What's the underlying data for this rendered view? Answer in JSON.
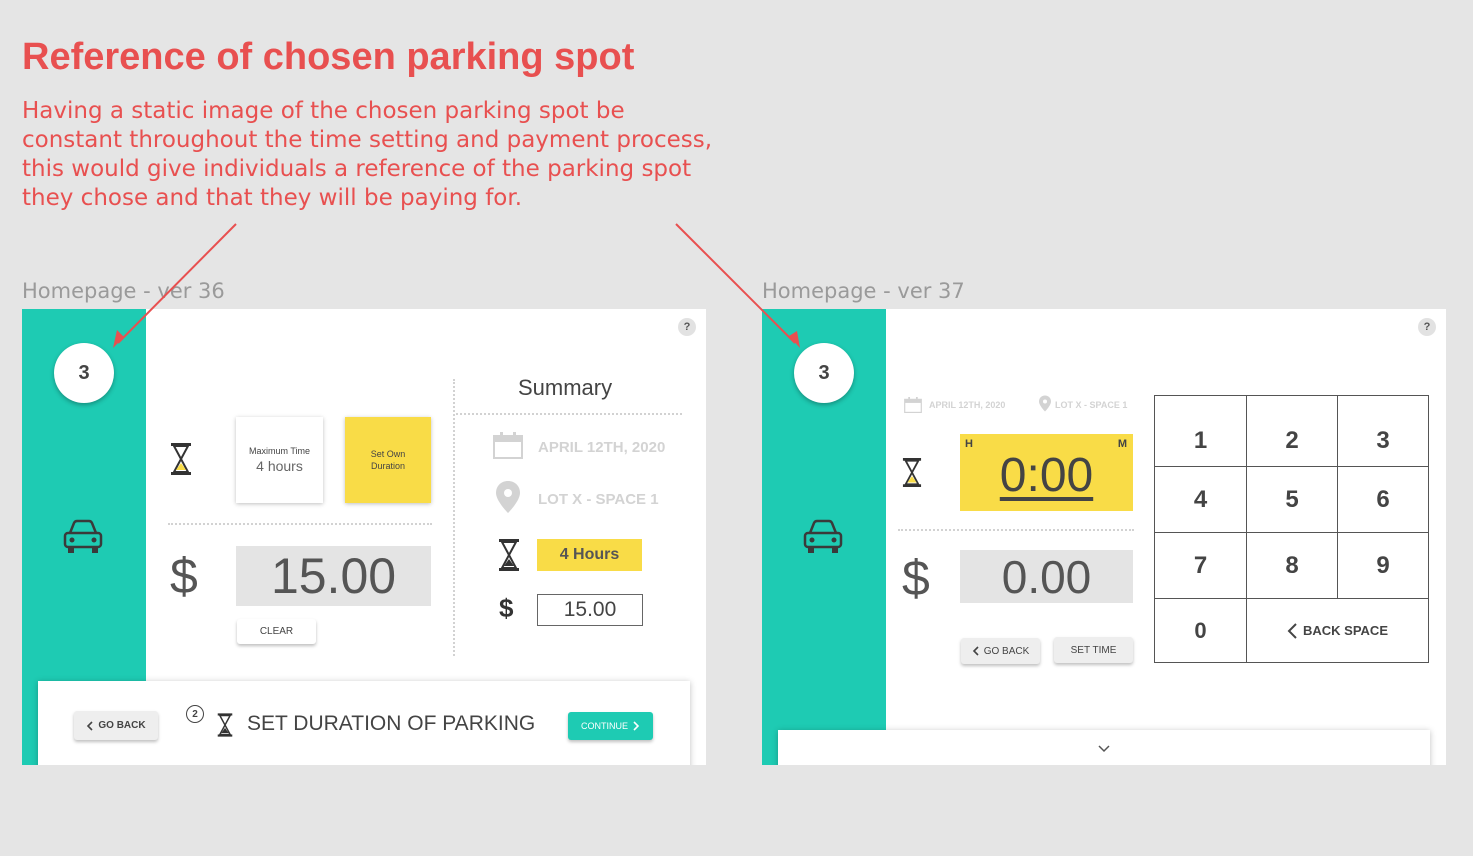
{
  "annotation": {
    "title": "Reference of chosen parking spot",
    "description": "Having a static image of the chosen parking spot be constant throughout the time setting and payment process, this would give individuals a reference of the parking spot they chose and that they will be paying for."
  },
  "colors": {
    "accent": "#1ecbb3",
    "highlight": "#f9dc47",
    "annotation": "#e85050"
  },
  "v36": {
    "label": "Homepage - ver 36",
    "step_number": "3",
    "help": "?",
    "max_time": {
      "title": "Maximum Time",
      "value": "4 hours"
    },
    "set_own_duration": "Set Own Duration",
    "currency_symbol": "$",
    "amount": "15.00",
    "clear_label": "CLEAR",
    "summary": {
      "title": "Summary",
      "date": "APRIL 12TH, 2020",
      "location": "LOT X - SPACE 1",
      "duration": "4 Hours",
      "price_symbol": "$",
      "price": "15.00"
    },
    "footer": {
      "go_back": "GO BACK",
      "step_badge": "2",
      "heading": "SET DURATION OF PARKING",
      "continue": "CONTINUE"
    }
  },
  "v37": {
    "label": "Homepage - ver 37",
    "step_number": "3",
    "help": "?",
    "date": "APRIL 12TH, 2020",
    "location": "LOT X - SPACE 1",
    "hours_label": "H",
    "minutes_label": "M",
    "time": "0:00",
    "currency_symbol": "$",
    "amount": "0.00",
    "go_back": "GO BACK",
    "set_time": "SET TIME",
    "keypad": [
      "1",
      "2",
      "3",
      "4",
      "5",
      "6",
      "7",
      "8",
      "9",
      "0"
    ],
    "backspace": "BACK SPACE"
  }
}
